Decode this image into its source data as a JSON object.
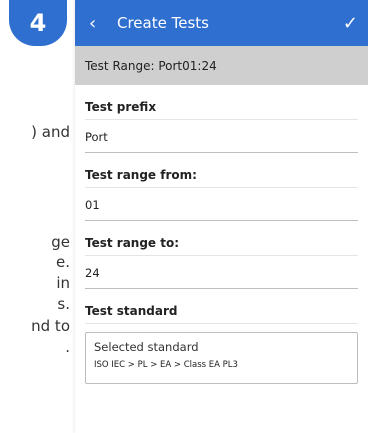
{
  "step_badge": "4",
  "instructions_fragments": [
    ") and",
    "ge",
    "e.",
    "in",
    "s.",
    "nd to",
    "."
  ],
  "appbar": {
    "back_icon": "chevron-left",
    "title": "Create Tests",
    "confirm_icon": "check"
  },
  "range_bar": "Test Range: Port01:24",
  "fields": {
    "prefix": {
      "label": "Test prefix",
      "value": "Port"
    },
    "from": {
      "label": "Test range from:",
      "value": "01"
    },
    "to": {
      "label": "Test range to:",
      "value": "24"
    },
    "standard": {
      "label": "Test standard",
      "box_title": "Selected standard",
      "path": "ISO IEC > PL > EA > Class EA PL3"
    }
  },
  "colors": {
    "accent": "#2f6fd0",
    "range_bar": "#cfcfcf"
  }
}
